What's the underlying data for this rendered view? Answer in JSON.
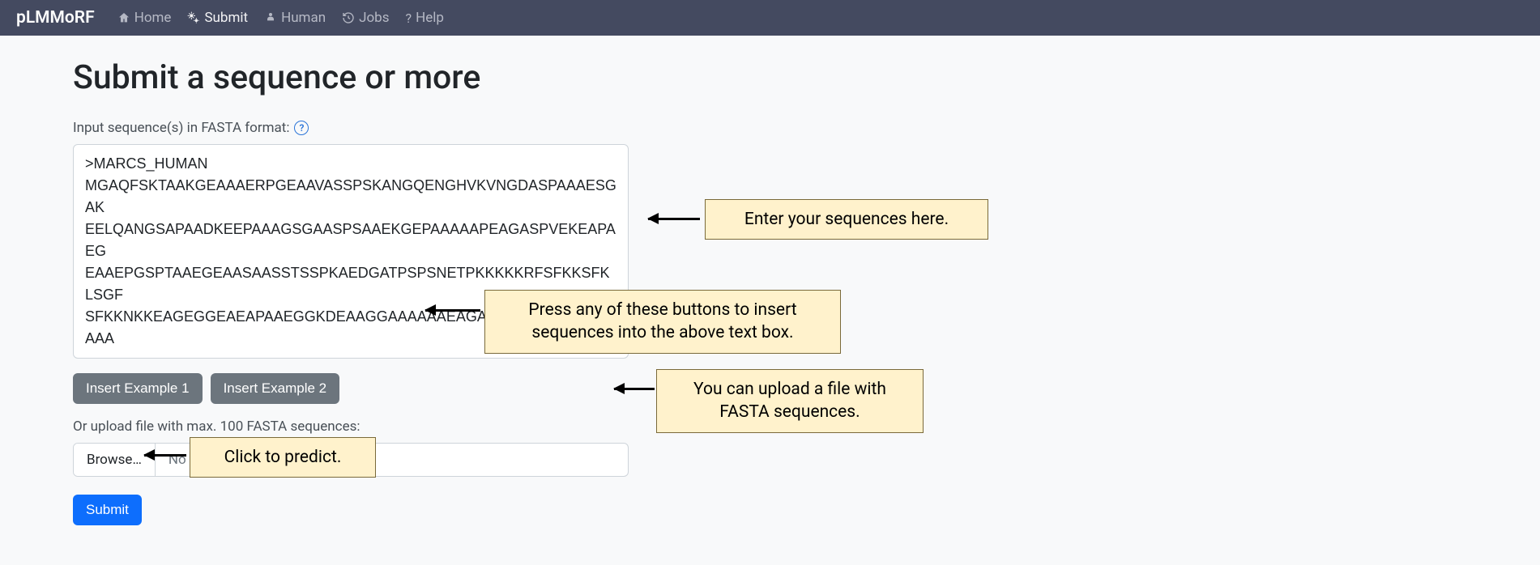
{
  "nav": {
    "brand": "pLMMoRF",
    "items": [
      {
        "label": "Home"
      },
      {
        "label": "Submit"
      },
      {
        "label": "Human"
      },
      {
        "label": "Jobs"
      },
      {
        "label": "Help"
      }
    ]
  },
  "page": {
    "heading": "Submit a sequence or more",
    "input_label": "Input sequence(s) in FASTA format:",
    "help_mark": "?",
    "textarea_value": ">MARCS_HUMAN\nMGAQFSKTAAKGEAAAERPGEAAVASSPSKANGQENGHVKVNGDASPAAAESGAK\nEELQANGSAPAADKEEPAAAGSGAASPSAAEKGEPAAAAAPEAGASPVEKEAPAEG\nEAAEPGSPTAAEGEAASAASSTSSPKAEDGATPSPSNETPKKKKKRFSFKKSFKLSGF\nSFKKNKKEAGEGGEAEAPAAEGGKDEAAGGAAAAAAEAGAASGEQAAAPGEEAAA",
    "example1_label": "Insert Example 1",
    "example2_label": "Insert Example 2",
    "upload_label": "Or upload file with max. 100 FASTA sequences:",
    "browse_label": "Browse…",
    "file_status": "No file selected.",
    "submit_label": "Submit"
  },
  "callouts": {
    "c1": "Enter your sequences here.",
    "c2": "Press any of these buttons to insert sequences into the above text box.",
    "c3": "You can upload a file with FASTA sequences.",
    "c4": "Click to predict."
  }
}
